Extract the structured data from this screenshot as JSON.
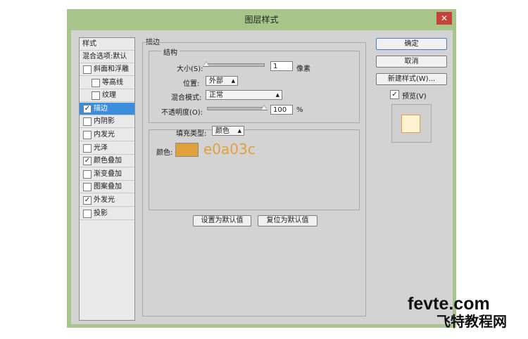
{
  "window": {
    "title": "图层样式",
    "close_label": "✕"
  },
  "styles": {
    "header": "样式",
    "blend_options": "混合选项:默认",
    "items": [
      {
        "label": "斜面和浮雕",
        "checked": false,
        "selected": false,
        "indent": false
      },
      {
        "label": "等高线",
        "checked": false,
        "selected": false,
        "indent": true
      },
      {
        "label": "纹理",
        "checked": false,
        "selected": false,
        "indent": true
      },
      {
        "label": "描边",
        "checked": true,
        "selected": true,
        "indent": false
      },
      {
        "label": "内阴影",
        "checked": false,
        "selected": false,
        "indent": false
      },
      {
        "label": "内发光",
        "checked": false,
        "selected": false,
        "indent": false
      },
      {
        "label": "光泽",
        "checked": false,
        "selected": false,
        "indent": false
      },
      {
        "label": "颜色叠加",
        "checked": true,
        "selected": false,
        "indent": false
      },
      {
        "label": "渐变叠加",
        "checked": false,
        "selected": false,
        "indent": false
      },
      {
        "label": "图案叠加",
        "checked": false,
        "selected": false,
        "indent": false
      },
      {
        "label": "外发光",
        "checked": true,
        "selected": false,
        "indent": false
      },
      {
        "label": "投影",
        "checked": false,
        "selected": false,
        "indent": false
      }
    ]
  },
  "stroke": {
    "section_title": "描边",
    "structure_title": "结构",
    "size_label": "大小(S):",
    "size_value": "1",
    "size_unit": "像素",
    "size_fraction": 0.0,
    "position_label": "位置:",
    "position_value": "外部",
    "blend_label": "混合模式:",
    "blend_value": "正常",
    "opacity_label": "不透明度(O):",
    "opacity_value": "100",
    "opacity_unit": "%",
    "opacity_fraction": 1.0,
    "fill_type_label": "填充类型:",
    "fill_type_value": "颜色",
    "color_label": "颜色:",
    "color_swatch": "#e0a03c",
    "color_hex_text": "e0a03c",
    "set_default_button": "设置为默认值",
    "reset_default_button": "复位为默认值"
  },
  "actions": {
    "ok": "确定",
    "cancel": "取消",
    "new_style": "新建样式(W)...",
    "preview_label": "预览(V)",
    "preview_checked": true,
    "preview_fill": "#fdf3d2"
  },
  "watermark": {
    "line1": "fevte.com",
    "line2": "飞特教程网"
  },
  "colors": {
    "frame": "#a7c489",
    "dialog": "#d3d3d3",
    "selection": "#3b8ede",
    "accent": "#e0a03c"
  }
}
